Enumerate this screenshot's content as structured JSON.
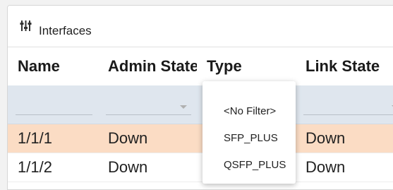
{
  "panel": {
    "title": "Interfaces",
    "icon": "sliders-icon"
  },
  "table": {
    "columns": [
      "Name",
      "Admin State",
      "Type",
      "Link State"
    ],
    "rows": [
      {
        "name": "1/1/1",
        "admin_state": "Down",
        "type": "",
        "link_state": "Down"
      },
      {
        "name": "1/1/2",
        "admin_state": "Down",
        "type": "",
        "link_state": "Down"
      }
    ]
  },
  "type_filter_dropdown": {
    "options": [
      "<No Filter>",
      "SFP_PLUS",
      "QSFP_PLUS"
    ]
  },
  "colors": {
    "selected_row": "#fbdcc4",
    "filter_row": "#dfe6ee"
  }
}
